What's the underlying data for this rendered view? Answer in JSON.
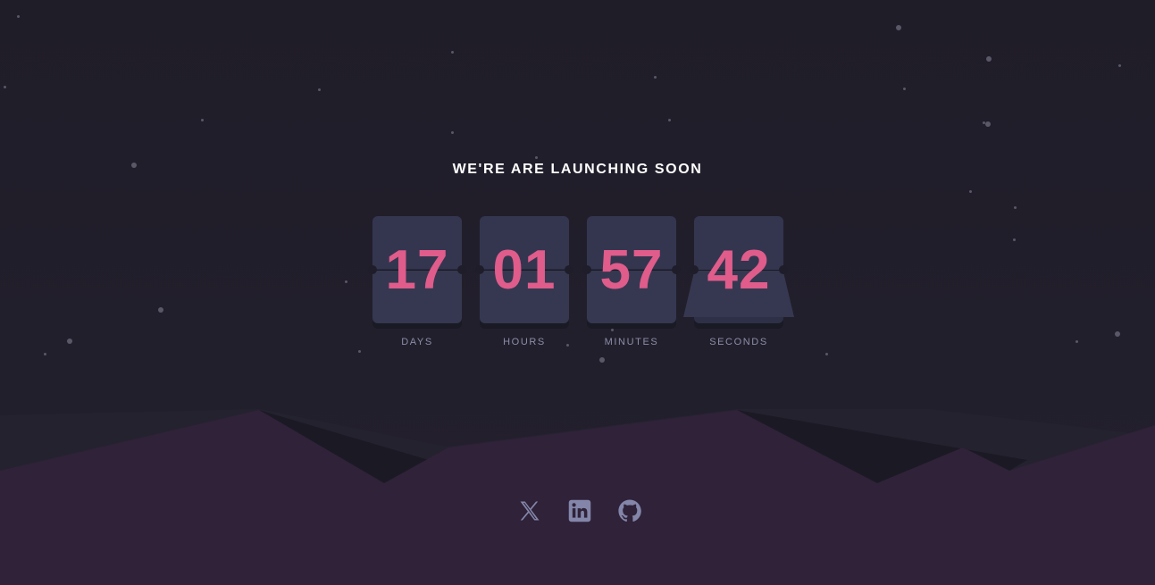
{
  "title": "WE'RE ARE LAUNCHING SOON",
  "countdown": [
    {
      "value": "17",
      "label": "DAYS"
    },
    {
      "value": "01",
      "label": "HOURS"
    },
    {
      "value": "57",
      "label": "MINUTES"
    },
    {
      "value": "42",
      "label": "SECONDS"
    }
  ],
  "colors": {
    "background": "#1f1d29",
    "card": "#343650",
    "digit": "#df5c8b",
    "label": "#8b8ea9",
    "hills": "#2f2239",
    "icon": "#8385a9"
  },
  "socials": [
    {
      "name": "x-icon"
    },
    {
      "name": "linkedin-icon"
    },
    {
      "name": "github-icon"
    }
  ]
}
